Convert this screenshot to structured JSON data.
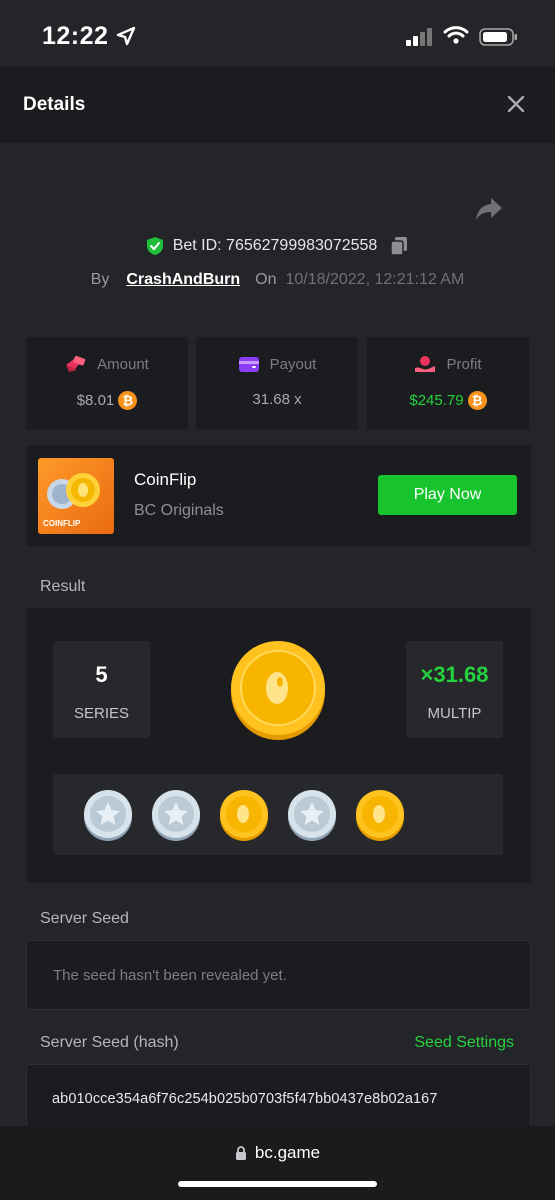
{
  "status_bar": {
    "time": "12:22"
  },
  "header": {
    "title": "Details"
  },
  "bet": {
    "id_label": "Bet ID: 76562799983072558",
    "by_label": "By",
    "user": "CrashAndBurn",
    "on_label": "On",
    "date": "10/18/2022, 12:21:12 AM"
  },
  "stats": {
    "amount": {
      "label": "Amount",
      "value": "$8.01"
    },
    "payout": {
      "label": "Payout",
      "value": "31.68 x"
    },
    "profit": {
      "label": "Profit",
      "value": "$245.79"
    }
  },
  "game": {
    "name": "CoinFlip",
    "provider": "BC Originals",
    "thumb_label": "COINFLIP",
    "play_label": "Play Now"
  },
  "result": {
    "label": "Result",
    "series_value": "5",
    "series_label": "SERIES",
    "multip_value": "×31.68",
    "multip_label": "MULTIP",
    "coins": [
      "silver",
      "silver",
      "gold",
      "silver",
      "gold"
    ]
  },
  "server_seed": {
    "label": "Server Seed",
    "text": "The seed hasn't been revealed yet."
  },
  "server_seed_hash": {
    "label": "Server Seed (hash)",
    "settings_label": "Seed Settings",
    "value": "ab010cce354a6f76c254b025b0703f5f47bb0437e8b02a167"
  },
  "browser": {
    "url": "bc.game"
  },
  "colors": {
    "accent_green": "#26d13e",
    "button_green": "#17c42d",
    "btc_orange": "#f7931a",
    "gold": "#f5b800"
  }
}
